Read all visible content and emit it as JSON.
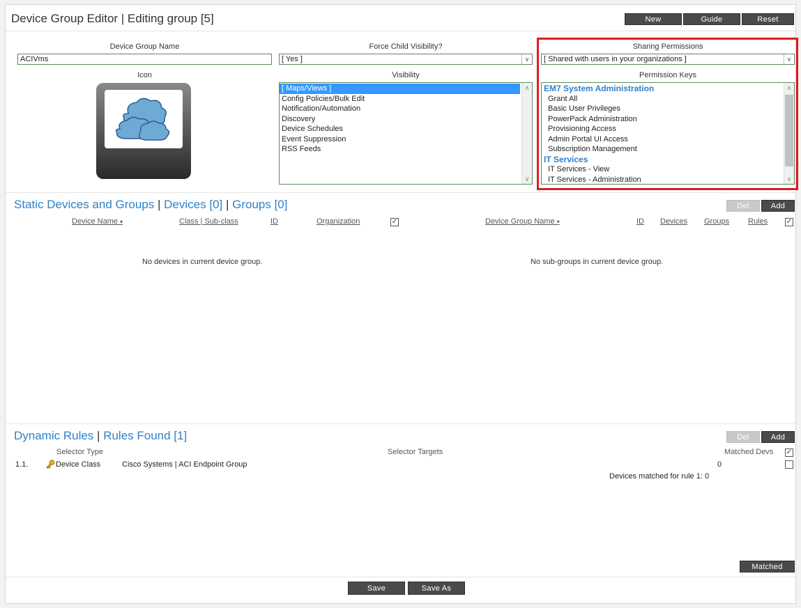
{
  "header": {
    "title": "Device Group Editor | Editing group [5]",
    "buttons": {
      "new": "New",
      "guide": "Guide",
      "reset": "Reset"
    }
  },
  "form": {
    "group_name_label": "Device Group Name",
    "group_name_value": "ACIVms",
    "force_child_label": "Force Child Visibility?",
    "force_child_value": "[ Yes ]",
    "sharing_label": "Sharing Permissions",
    "sharing_value": "[ Shared with users in your organizations ]",
    "icon_label": "Icon",
    "visibility_label": "Visibility",
    "visibility_items": [
      "[ Maps/Views ]",
      "Config Policies/Bulk Edit",
      "Notification/Automation",
      "Discovery",
      "Device Schedules",
      "Event Suppression",
      "RSS Feeds"
    ],
    "permission_keys_label": "Permission Keys",
    "permission_keys": [
      {
        "text": "EM7 System Administration",
        "group": true
      },
      {
        "text": "Grant All",
        "group": false
      },
      {
        "text": "Basic User Privileges",
        "group": false
      },
      {
        "text": "PowerPack Administration",
        "group": false
      },
      {
        "text": "Provisioning Access",
        "group": false
      },
      {
        "text": "Admin Portal UI Access",
        "group": false
      },
      {
        "text": "Subscription Management",
        "group": false
      },
      {
        "text": "IT Services",
        "group": true
      },
      {
        "text": "IT Services - View",
        "group": false
      },
      {
        "text": "IT Services - Administration",
        "group": false
      }
    ]
  },
  "static": {
    "title_a": "Static Devices and Groups",
    "title_sep1": " | ",
    "title_b": "Devices [0]",
    "title_sep2": " | ",
    "title_c": "Groups [0]",
    "del": "Del",
    "add": "Add",
    "cols_left": {
      "device_name": "Device Name",
      "class": "Class | Sub-class",
      "id": "ID",
      "org": "Organization"
    },
    "cols_right": {
      "group_name": "Device Group Name",
      "id": "ID",
      "devices": "Devices",
      "groups": "Groups",
      "rules": "Rules"
    },
    "sort_glyph": "▾",
    "empty_left": "No devices in current device group.",
    "empty_right": "No sub-groups in current device group."
  },
  "dynamic": {
    "title_a": "Dynamic Rules",
    "title_sep": " | ",
    "title_b": "Rules Found [1]",
    "del": "Del",
    "add": "Add",
    "col_selector_type": "Selector Type",
    "col_selector_targets": "Selector Targets",
    "col_matched": "Matched Devs",
    "row": {
      "index": "1.1.",
      "type": "Device Class",
      "target": "Cisco Systems | ACI Endpoint Group",
      "matched": "0"
    },
    "summary": "Devices matched for rule 1:  0",
    "matched_button": "Matched"
  },
  "footer": {
    "save": "Save",
    "save_as": "Save As"
  },
  "colors": {
    "accent": "#2f82c9",
    "highlight": "#e01b22",
    "button": "#4a4a4a"
  }
}
